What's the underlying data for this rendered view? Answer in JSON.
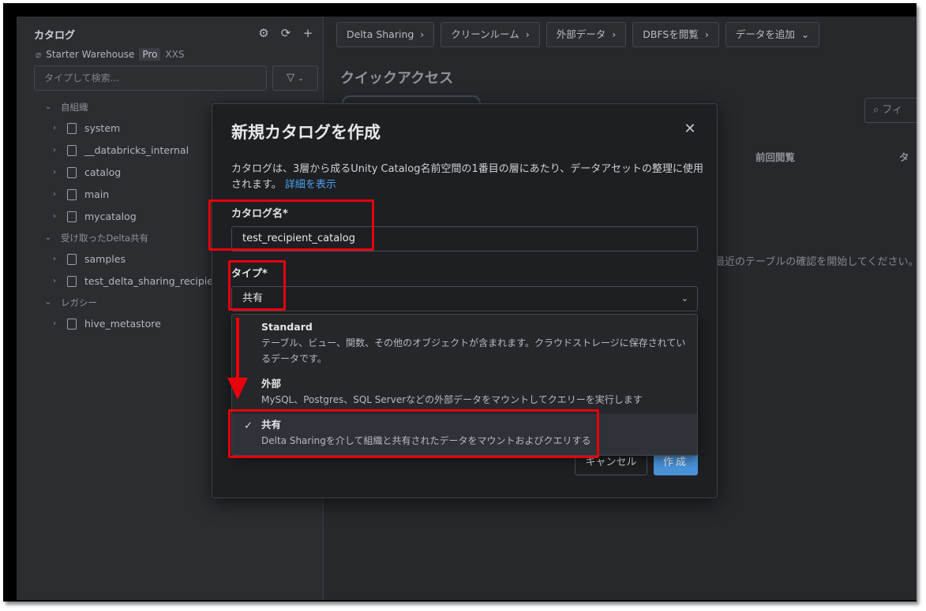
{
  "sidebar": {
    "title": "カタログ",
    "warehouse_name": "Starter Warehouse",
    "warehouse_tier": "Pro",
    "warehouse_size": "XXS",
    "search_placeholder": "タイプして検索...",
    "sections": [
      {
        "label": "自組織",
        "items": [
          "system",
          "__databricks_internal",
          "catalog",
          "main",
          "mycatalog"
        ]
      },
      {
        "label": "受け取ったDelta共有",
        "items": [
          "samples",
          "test_delta_sharing_recipient"
        ]
      },
      {
        "label": "レガシー",
        "items": [
          "hive_metastore"
        ]
      }
    ]
  },
  "topbar": {
    "buttons": [
      "Delta Sharing",
      "クリーンルーム",
      "外部データ",
      "DBFSを閲覧",
      "データを追加"
    ]
  },
  "quick_access": {
    "title": "クイックアクセス",
    "filter_placeholder": "フィ",
    "col_prev": "前回閲覧",
    "col_type": "タ",
    "empty_text": "最近のテーブルの確認を開始してください。"
  },
  "modal": {
    "title": "新規カタログを作成",
    "description": "カタログは、3層から成るUnity Catalog名前空間の1番目の層にあたり、データアセットの整理に使用されます。",
    "link": "詳細を表示",
    "name_label": "カタログ名*",
    "name_value": "test_recipient_catalog",
    "type_label": "タイプ*",
    "type_value": "共有",
    "cancel_label": "キャンセル",
    "create_label": "作成",
    "options": [
      {
        "title": "Standard",
        "desc": "テーブル、ビュー、関数、その他のオブジェクトが含まれます。クラウドストレージに保存されているデータです。",
        "selected": false
      },
      {
        "title": "外部",
        "desc": "MySQL、Postgres、SQL Serverなどの外部データをマウントしてクエリーを実行します",
        "selected": false
      },
      {
        "title": "共有",
        "desc": "Delta Sharingを介して組織と共有されたデータをマウントおよびクエリする",
        "selected": true
      }
    ]
  },
  "colors": {
    "accent": "#4a93d9",
    "annotation_red": "#e8000b",
    "modal_bg": "#1e1f22"
  }
}
